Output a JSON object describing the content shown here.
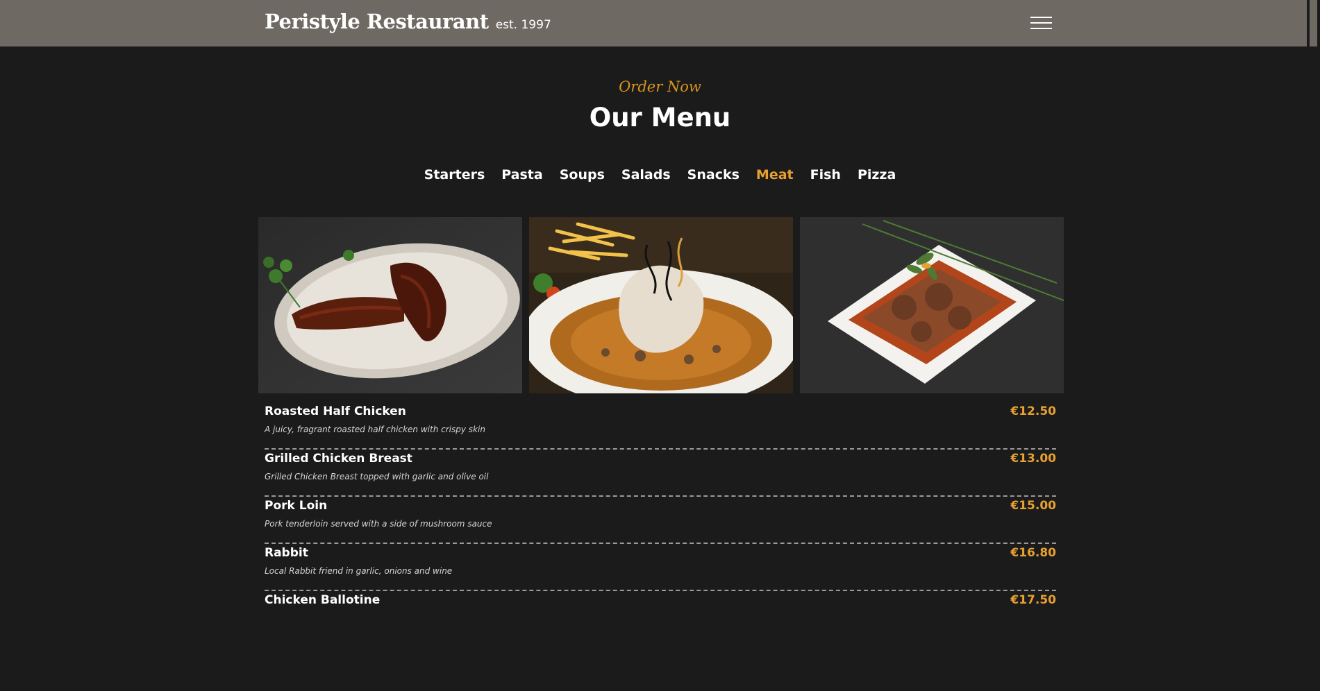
{
  "header": {
    "brand_name": "Peristyle Restaurant",
    "brand_est": "est. 1997",
    "menu_icon": "hamburger-menu-icon"
  },
  "section": {
    "subtitle": "Order Now",
    "title": "Our Menu"
  },
  "tabs": [
    {
      "label": "Starters",
      "active": false
    },
    {
      "label": "Pasta",
      "active": false
    },
    {
      "label": "Soups",
      "active": false
    },
    {
      "label": "Salads",
      "active": false
    },
    {
      "label": "Snacks",
      "active": false
    },
    {
      "label": "Meat",
      "active": true
    },
    {
      "label": "Fish",
      "active": false
    },
    {
      "label": "Pizza",
      "active": false
    }
  ],
  "items": [
    {
      "name": "Roasted Half Chicken",
      "desc": "A juicy, fragrant roasted half chicken with crispy skin",
      "price": "€12.50"
    },
    {
      "name": "Grilled Chicken Breast",
      "desc": "Grilled Chicken Breast topped with garlic and olive oil",
      "price": "€13.00"
    },
    {
      "name": "Pork Loin",
      "desc": "Pork tenderloin served with a side of mushroom sauce",
      "price": "€15.00"
    },
    {
      "name": "Rabbit",
      "desc": "Local Rabbit friend in garlic, onions and wine",
      "price": "€16.80"
    },
    {
      "name": "Chicken Ballotine",
      "desc": "",
      "price": "€17.50"
    }
  ],
  "colors": {
    "accent": "#e8a030",
    "header_bg": "#6f6964",
    "page_bg": "#1b1b1b"
  }
}
